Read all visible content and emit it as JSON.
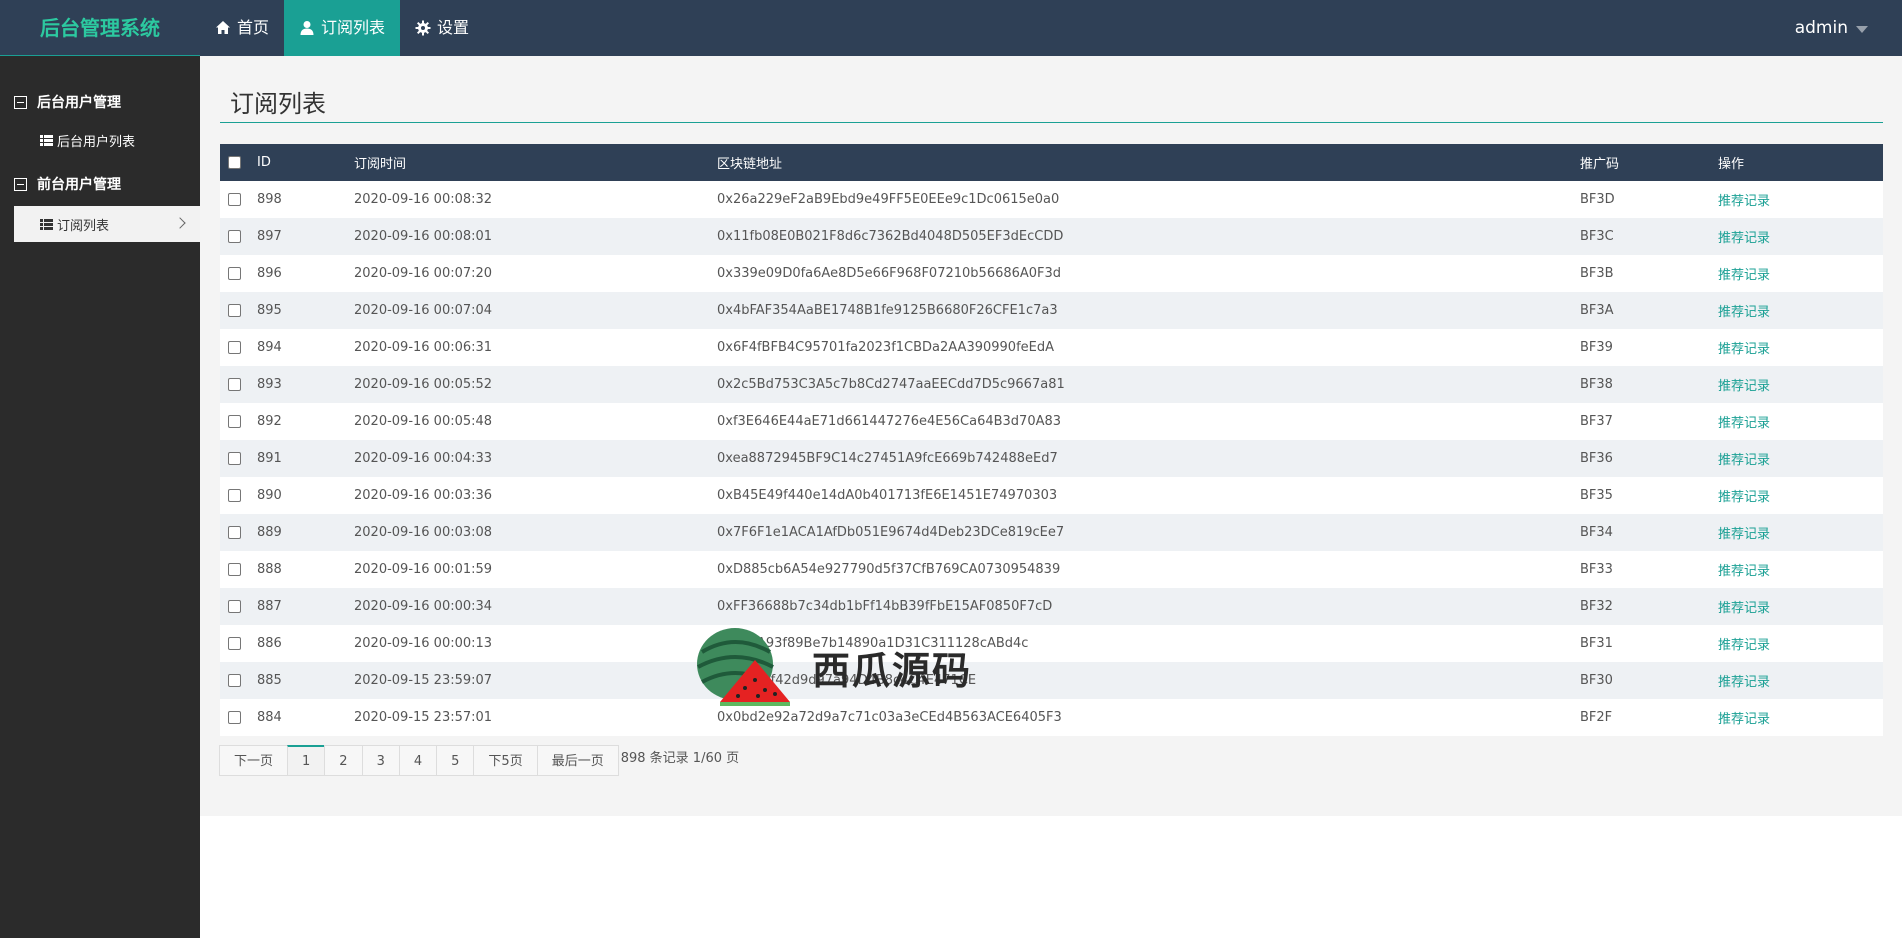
{
  "brand": "后台管理系统",
  "topnav": [
    {
      "label": "首页",
      "icon": "home-icon"
    },
    {
      "label": "订阅列表",
      "icon": "user-icon"
    },
    {
      "label": "设置",
      "icon": "gear-icon"
    }
  ],
  "user": "admin",
  "sidebar": {
    "groups": [
      {
        "label": "后台用户管理",
        "items": [
          "后台用户列表"
        ]
      },
      {
        "label": "前台用户管理",
        "items": [
          "订阅列表"
        ]
      }
    ]
  },
  "page_title": "订阅列表",
  "table": {
    "headers": [
      "ID",
      "订阅时间",
      "区块链地址",
      "推广码",
      "操作"
    ],
    "rows": [
      {
        "id": "898",
        "time": "2020-09-16 00:08:32",
        "addr": "0x26a229eF2aB9Ebd9e49FF5E0EEe9c1Dc0615e0a0",
        "code": "BF3D",
        "op": "推荐记录"
      },
      {
        "id": "897",
        "time": "2020-09-16 00:08:01",
        "addr": "0x11fb08E0B021F8d6c7362Bd4048D505EF3dEcCDD",
        "code": "BF3C",
        "op": "推荐记录"
      },
      {
        "id": "896",
        "time": "2020-09-16 00:07:20",
        "addr": "0x339e09D0fa6Ae8D5e66F968F07210b56686A0F3d",
        "code": "BF3B",
        "op": "推荐记录"
      },
      {
        "id": "895",
        "time": "2020-09-16 00:07:04",
        "addr": "0x4bFAF354AaBE1748B1fe9125B6680F26CFE1c7a3",
        "code": "BF3A",
        "op": "推荐记录"
      },
      {
        "id": "894",
        "time": "2020-09-16 00:06:31",
        "addr": "0x6F4fBFB4C95701fa2023f1CBDa2AA390990feEdA",
        "code": "BF39",
        "op": "推荐记录"
      },
      {
        "id": "893",
        "time": "2020-09-16 00:05:52",
        "addr": "0x2c5Bd753C3A5c7b8Cd2747aaEECdd7D5c9667a81",
        "code": "BF38",
        "op": "推荐记录"
      },
      {
        "id": "892",
        "time": "2020-09-16 00:05:48",
        "addr": "0xf3E646E44aE71d661447276e4E56Ca64B3d70A83",
        "code": "BF37",
        "op": "推荐记录"
      },
      {
        "id": "891",
        "time": "2020-09-16 00:04:33",
        "addr": "0xea8872945BF9C14c27451A9fcE669b742488eEd7",
        "code": "BF36",
        "op": "推荐记录"
      },
      {
        "id": "890",
        "time": "2020-09-16 00:03:36",
        "addr": "0xB45E49f440e14dA0b401713fE6E1451E74970303",
        "code": "BF35",
        "op": "推荐记录"
      },
      {
        "id": "889",
        "time": "2020-09-16 00:03:08",
        "addr": "0x7F6F1e1ACA1AfDb051E9674d4Deb23DCe819cEe7",
        "code": "BF34",
        "op": "推荐记录"
      },
      {
        "id": "888",
        "time": "2020-09-16 00:01:59",
        "addr": "0xD885cb6A54e927790d5f37CfB769CA0730954839",
        "code": "BF33",
        "op": "推荐记录"
      },
      {
        "id": "887",
        "time": "2020-09-16 00:00:34",
        "addr": "0xFF36688b7c34db1bFf14bB39fFbE15AF0850F7cD",
        "code": "BF32",
        "op": "推荐记录"
      },
      {
        "id": "886",
        "time": "2020-09-16 00:00:13",
        "addr": "0x1F2A93f89Be7b14890a1D31C311128cABd4c",
        "code": "BF31",
        "op": "推荐记录"
      },
      {
        "id": "885",
        "time": "2020-09-15 23:59:07",
        "addr": "0xf4394f42d9d97a94D4B8c4C4E471CE",
        "code": "BF30",
        "op": "推荐记录"
      },
      {
        "id": "884",
        "time": "2020-09-15 23:57:01",
        "addr": "0x0bd2e92a72d9a7c71c03a3eCEd4B563ACE6405F3",
        "code": "BF2F",
        "op": "推荐记录"
      }
    ]
  },
  "pager": {
    "prev": "下一页",
    "pages": [
      "1",
      "2",
      "3",
      "4",
      "5"
    ],
    "next5": "下5页",
    "last": "最后一页",
    "info": "898 条记录 1/60 页"
  },
  "watermark": "西瓜源码",
  "colors": {
    "topbar": "#2f4056",
    "accent": "#1aa094",
    "sidebar": "#2b2b2b"
  }
}
